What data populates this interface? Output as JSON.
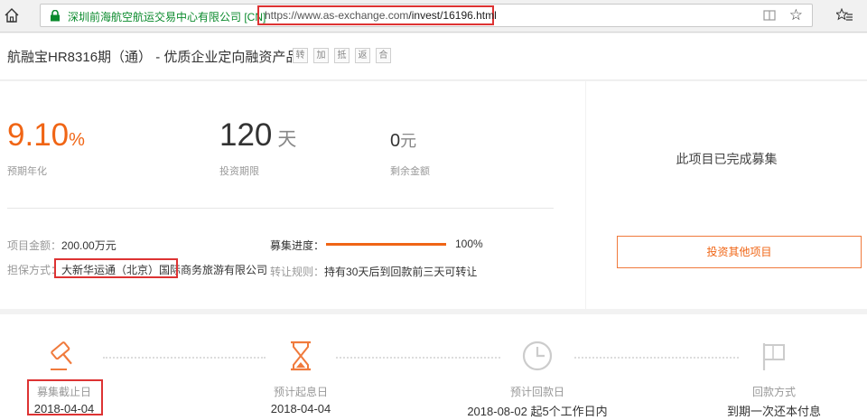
{
  "browser": {
    "site_identity": "深圳前海航空航运交易中心有限公司 [CN]",
    "url_host": "https://www.as-exchange.com",
    "url_path": "/invest/16196.html"
  },
  "product": {
    "title": "航融宝HR8316期（通） - 优质企业定向融资产品",
    "tags": [
      "转",
      "加",
      "抵",
      "返",
      "合"
    ]
  },
  "stats": {
    "rate_value": "9.10",
    "rate_unit": "%",
    "rate_label": "预期年化",
    "term_value": "120",
    "term_unit": "天",
    "term_label": "投资期限",
    "remain_value": "0",
    "remain_unit": "元",
    "remain_label": "剩余金额"
  },
  "details": {
    "amount_label": "项目金额：",
    "amount_value": "200.00万元",
    "guarantee_label": "担保方式：",
    "guarantee_value": "大新华运通（北京）国际商务旅游有限公司",
    "progress_label": "募集进度：",
    "progress_value": "100%",
    "progress_fraction": 1.0,
    "rule_label": "转让规则：",
    "rule_value": "持有30天后到回款前三天可转让"
  },
  "status": {
    "done_text": "此项目已完成募集",
    "invest_button": "投资其他项目"
  },
  "colors": {
    "accent": "#f06515",
    "highlight_box": "#dd3333"
  },
  "timeline": {
    "steps": [
      {
        "label": "募集截止日",
        "value": "2018-04-04",
        "icon": "auction-hammer-icon"
      },
      {
        "label": "预计起息日",
        "value": "2018-04-04",
        "icon": "hourglass-icon"
      },
      {
        "label": "预计回款日",
        "value": "2018-08-02 起5个工作日内",
        "icon": "clock-icon"
      },
      {
        "label": "回款方式",
        "value": "到期一次还本付息",
        "icon": "flag-icon"
      }
    ]
  }
}
